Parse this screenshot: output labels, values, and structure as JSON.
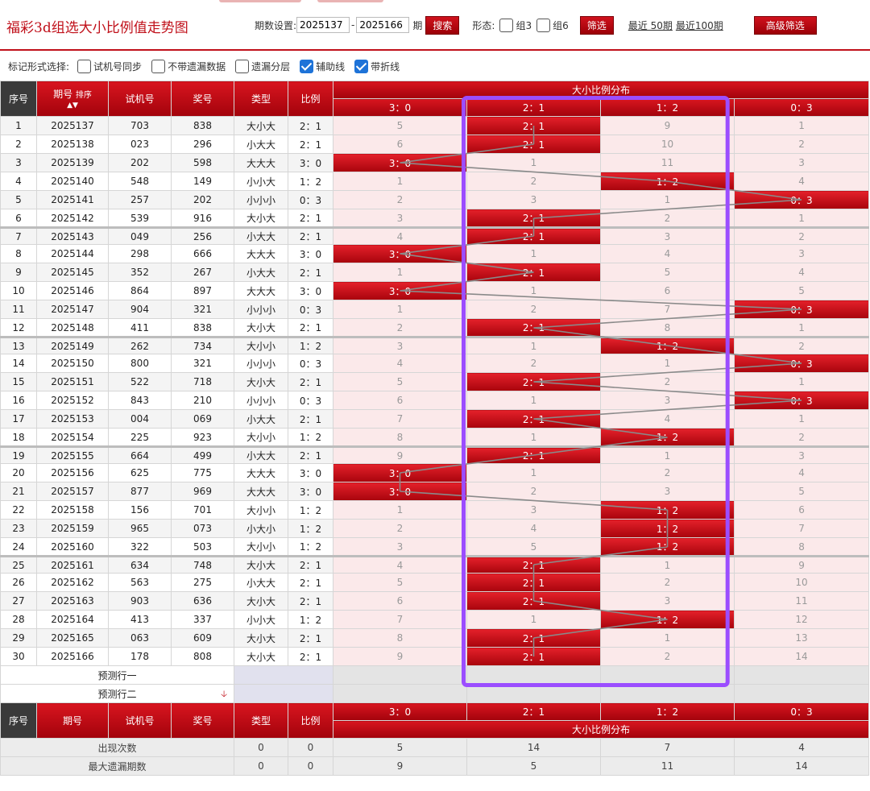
{
  "title": "福彩3d组选大小比例值走势图",
  "controls": {
    "period_label": "期数设置:",
    "period_from": "2025137",
    "period_to": "2025166",
    "period_suffix": "期",
    "search_label": "搜索",
    "form_label": "形态:",
    "group3_label": "组3",
    "group6_label": "组6",
    "filter_label": "筛选",
    "recent50_label": "最近 50期",
    "recent100_label": "最近100期",
    "advanced_label": "高级筛选"
  },
  "mark_options": {
    "label": "标记形式选择:",
    "items": [
      {
        "label": "试机号同步",
        "checked": false
      },
      {
        "label": "不带遗漏数据",
        "checked": false
      },
      {
        "label": "遗漏分层",
        "checked": false
      },
      {
        "label": "辅助线",
        "checked": true
      },
      {
        "label": "带折线",
        "checked": true
      }
    ]
  },
  "headers": {
    "seq": "序号",
    "issue": "期号",
    "sort": "排序",
    "trial": "试机号",
    "prize": "奖号",
    "type": "类型",
    "ratio": "比例",
    "dist": "大小比例分布",
    "cols": [
      "3：0",
      "2：1",
      "1：2",
      "0：3"
    ]
  },
  "colors": {
    "accent_red": "#c0101a",
    "highlight_box": "#9b4dff",
    "hit_gradient_top": "#e4202a",
    "hit_gradient_bottom": "#a8040c",
    "miss_background": "#fbe9ea"
  },
  "chart_data": {
    "type": "table",
    "title": "福彩3d组选大小比例值走势图",
    "columns": [
      "3：0",
      "2：1",
      "1：2",
      "0：3"
    ],
    "rows": [
      {
        "seq": "1",
        "issue": "2025137",
        "trial": "703",
        "prize": "838",
        "type": "大小大",
        "ratio": "2：1",
        "dist": [
          "5",
          "2：1",
          "9",
          "1"
        ],
        "hit": 1
      },
      {
        "seq": "2",
        "issue": "2025138",
        "trial": "023",
        "prize": "296",
        "type": "小大大",
        "ratio": "2：1",
        "dist": [
          "6",
          "2：1",
          "10",
          "2"
        ],
        "hit": 1
      },
      {
        "seq": "3",
        "issue": "2025139",
        "trial": "202",
        "prize": "598",
        "type": "大大大",
        "ratio": "3：0",
        "dist": [
          "3：0",
          "1",
          "11",
          "3"
        ],
        "hit": 0
      },
      {
        "seq": "4",
        "issue": "2025140",
        "trial": "548",
        "prize": "149",
        "type": "小小大",
        "ratio": "1：2",
        "dist": [
          "1",
          "2",
          "1：2",
          "4"
        ],
        "hit": 2
      },
      {
        "seq": "5",
        "issue": "2025141",
        "trial": "257",
        "prize": "202",
        "type": "小小小",
        "ratio": "0：3",
        "dist": [
          "2",
          "3",
          "1",
          "0：3"
        ],
        "hit": 3
      },
      {
        "seq": "6",
        "issue": "2025142",
        "trial": "539",
        "prize": "916",
        "type": "大小大",
        "ratio": "2：1",
        "dist": [
          "3",
          "2：1",
          "2",
          "1"
        ],
        "hit": 1
      },
      {
        "seq": "7",
        "issue": "2025143",
        "trial": "049",
        "prize": "256",
        "type": "小大大",
        "ratio": "2：1",
        "dist": [
          "4",
          "2：1",
          "3",
          "2"
        ],
        "hit": 1
      },
      {
        "seq": "8",
        "issue": "2025144",
        "trial": "298",
        "prize": "666",
        "type": "大大大",
        "ratio": "3：0",
        "dist": [
          "3：0",
          "1",
          "4",
          "3"
        ],
        "hit": 0
      },
      {
        "seq": "9",
        "issue": "2025145",
        "trial": "352",
        "prize": "267",
        "type": "小大大",
        "ratio": "2：1",
        "dist": [
          "1",
          "2：1",
          "5",
          "4"
        ],
        "hit": 1
      },
      {
        "seq": "10",
        "issue": "2025146",
        "trial": "864",
        "prize": "897",
        "type": "大大大",
        "ratio": "3：0",
        "dist": [
          "3：0",
          "1",
          "6",
          "5"
        ],
        "hit": 0
      },
      {
        "seq": "11",
        "issue": "2025147",
        "trial": "904",
        "prize": "321",
        "type": "小小小",
        "ratio": "0：3",
        "dist": [
          "1",
          "2",
          "7",
          "0：3"
        ],
        "hit": 3
      },
      {
        "seq": "12",
        "issue": "2025148",
        "trial": "411",
        "prize": "838",
        "type": "大小大",
        "ratio": "2：1",
        "dist": [
          "2",
          "2：1",
          "8",
          "1"
        ],
        "hit": 1
      },
      {
        "seq": "13",
        "issue": "2025149",
        "trial": "262",
        "prize": "734",
        "type": "大小小",
        "ratio": "1：2",
        "dist": [
          "3",
          "1",
          "1：2",
          "2"
        ],
        "hit": 2
      },
      {
        "seq": "14",
        "issue": "2025150",
        "trial": "800",
        "prize": "321",
        "type": "小小小",
        "ratio": "0：3",
        "dist": [
          "4",
          "2",
          "1",
          "0：3"
        ],
        "hit": 3
      },
      {
        "seq": "15",
        "issue": "2025151",
        "trial": "522",
        "prize": "718",
        "type": "大小大",
        "ratio": "2：1",
        "dist": [
          "5",
          "2：1",
          "2",
          "1"
        ],
        "hit": 1
      },
      {
        "seq": "16",
        "issue": "2025152",
        "trial": "843",
        "prize": "210",
        "type": "小小小",
        "ratio": "0：3",
        "dist": [
          "6",
          "1",
          "3",
          "0：3"
        ],
        "hit": 3
      },
      {
        "seq": "17",
        "issue": "2025153",
        "trial": "004",
        "prize": "069",
        "type": "小大大",
        "ratio": "2：1",
        "dist": [
          "7",
          "2：1",
          "4",
          "1"
        ],
        "hit": 1
      },
      {
        "seq": "18",
        "issue": "2025154",
        "trial": "225",
        "prize": "923",
        "type": "大小小",
        "ratio": "1：2",
        "dist": [
          "8",
          "1",
          "1：2",
          "2"
        ],
        "hit": 2
      },
      {
        "seq": "19",
        "issue": "2025155",
        "trial": "664",
        "prize": "499",
        "type": "小大大",
        "ratio": "2：1",
        "dist": [
          "9",
          "2：1",
          "1",
          "3"
        ],
        "hit": 1
      },
      {
        "seq": "20",
        "issue": "2025156",
        "trial": "625",
        "prize": "775",
        "type": "大大大",
        "ratio": "3：0",
        "dist": [
          "3：0",
          "1",
          "2",
          "4"
        ],
        "hit": 0
      },
      {
        "seq": "21",
        "issue": "2025157",
        "trial": "877",
        "prize": "969",
        "type": "大大大",
        "ratio": "3：0",
        "dist": [
          "3：0",
          "2",
          "3",
          "5"
        ],
        "hit": 0
      },
      {
        "seq": "22",
        "issue": "2025158",
        "trial": "156",
        "prize": "701",
        "type": "大小小",
        "ratio": "1：2",
        "dist": [
          "1",
          "3",
          "1：2",
          "6"
        ],
        "hit": 2
      },
      {
        "seq": "23",
        "issue": "2025159",
        "trial": "965",
        "prize": "073",
        "type": "小大小",
        "ratio": "1：2",
        "dist": [
          "2",
          "4",
          "1：2",
          "7"
        ],
        "hit": 2
      },
      {
        "seq": "24",
        "issue": "2025160",
        "trial": "322",
        "prize": "503",
        "type": "大小小",
        "ratio": "1：2",
        "dist": [
          "3",
          "5",
          "1：2",
          "8"
        ],
        "hit": 2
      },
      {
        "seq": "25",
        "issue": "2025161",
        "trial": "634",
        "prize": "748",
        "type": "大小大",
        "ratio": "2：1",
        "dist": [
          "4",
          "2：1",
          "1",
          "9"
        ],
        "hit": 1
      },
      {
        "seq": "26",
        "issue": "2025162",
        "trial": "563",
        "prize": "275",
        "type": "小大大",
        "ratio": "2：1",
        "dist": [
          "5",
          "2：1",
          "2",
          "10"
        ],
        "hit": 1
      },
      {
        "seq": "27",
        "issue": "2025163",
        "trial": "903",
        "prize": "636",
        "type": "大小大",
        "ratio": "2：1",
        "dist": [
          "6",
          "2：1",
          "3",
          "11"
        ],
        "hit": 1
      },
      {
        "seq": "28",
        "issue": "2025164",
        "trial": "413",
        "prize": "337",
        "type": "小小大",
        "ratio": "1：2",
        "dist": [
          "7",
          "1",
          "1：2",
          "12"
        ],
        "hit": 2
      },
      {
        "seq": "29",
        "issue": "2025165",
        "trial": "063",
        "prize": "609",
        "type": "大小大",
        "ratio": "2：1",
        "dist": [
          "8",
          "2：1",
          "1",
          "13"
        ],
        "hit": 1
      },
      {
        "seq": "30",
        "issue": "2025166",
        "trial": "178",
        "prize": "808",
        "type": "大小大",
        "ratio": "2：1",
        "dist": [
          "9",
          "2：1",
          "2",
          "14"
        ],
        "hit": 1
      }
    ]
  },
  "predict": {
    "row1": "预测行一",
    "row2": "预测行二"
  },
  "stats": [
    {
      "label": "出现次数",
      "type": "0",
      "ratio": "0",
      "values": [
        "5",
        "14",
        "7",
        "4"
      ]
    },
    {
      "label": "最大遗漏期数",
      "type": "0",
      "ratio": "0",
      "values": [
        "9",
        "5",
        "11",
        "14"
      ]
    }
  ]
}
